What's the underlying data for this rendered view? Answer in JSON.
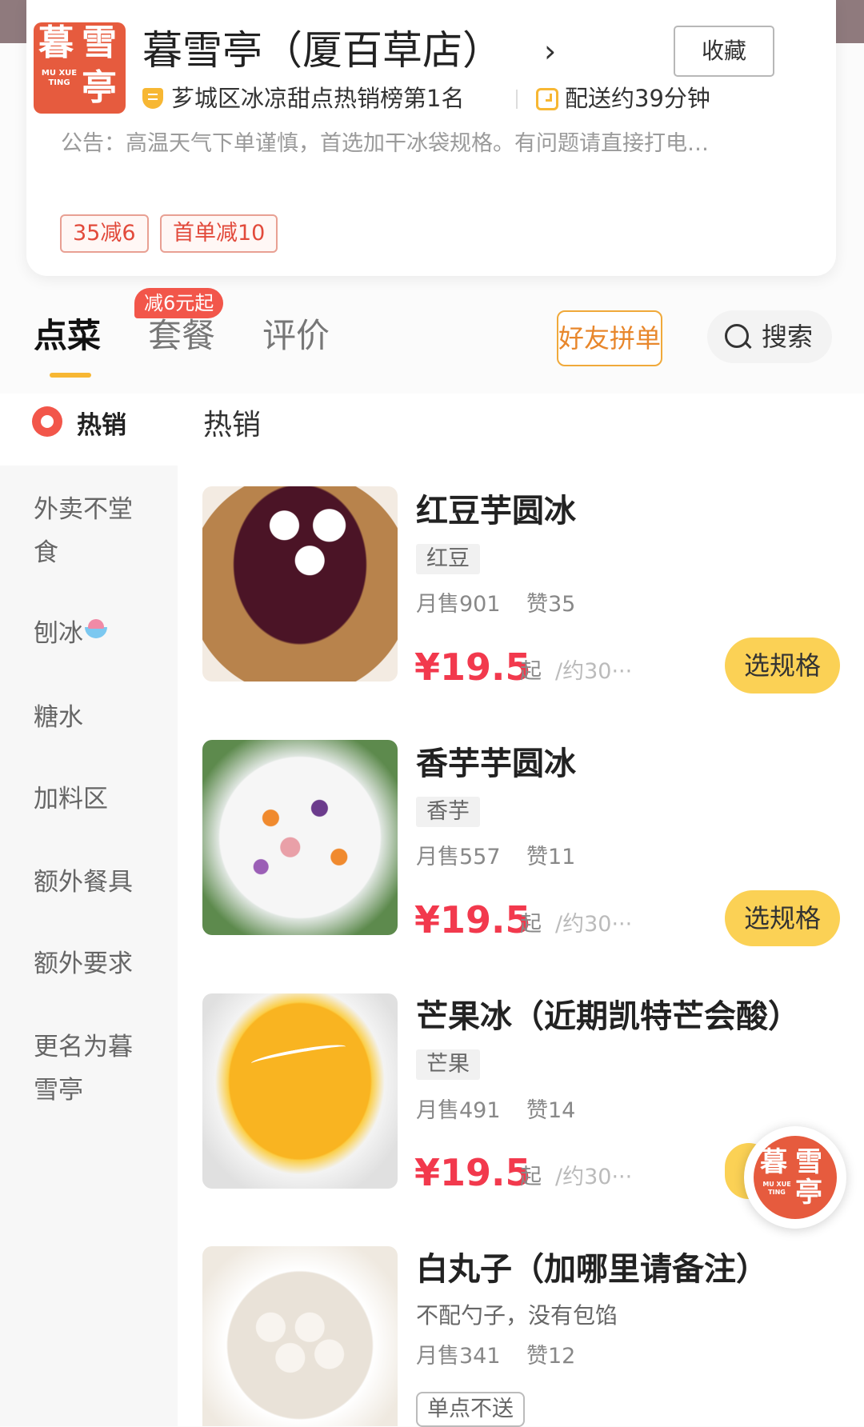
{
  "store": {
    "logo_chars": [
      "暮",
      "雪",
      "亭"
    ],
    "logo_small": "MU XUE TING",
    "name": "暮雪亭（厦百草店）",
    "chevron": "›",
    "favorite_label": "收藏",
    "ranking": "芗城区冰凉甜点热销榜第1名",
    "delivery": "配送约39分钟",
    "notice": "公告：高温天气下单谨慎，首选加干冰袋规格。有问题请直接打电…",
    "coupons": [
      "35减6",
      "首单减10"
    ]
  },
  "tabs": {
    "dishes": "点菜",
    "sets": "套餐",
    "reviews": "评价",
    "sets_badge": "减6元起",
    "group_order": "好友拼单",
    "search": "搜索"
  },
  "sidebar": {
    "items": [
      "热销",
      "外卖不堂食",
      "刨冰",
      "糖水",
      "加料区",
      "额外餐具",
      "额外要求",
      "更名为暮雪亭"
    ]
  },
  "section_title": "热销",
  "dishes": [
    {
      "name": "红豆芋圆冰",
      "tag": "红豆",
      "sales": "月售901",
      "likes": "赞35",
      "price": "¥19.5",
      "price_suffix": "起",
      "unit": "/约30···",
      "button": "选规格"
    },
    {
      "name": "香芋芋圆冰",
      "tag": "香芋",
      "sales": "月售557",
      "likes": "赞11",
      "price": "¥19.5",
      "price_suffix": "起",
      "unit": "/约30···",
      "button": "选规格"
    },
    {
      "name": "芒果冰（近期凯特芒会酸）",
      "tag": "芒果",
      "sales": "月售491",
      "likes": "赞14",
      "price": "¥19.5",
      "price_suffix": "起",
      "unit": "/约30···"
    },
    {
      "name": "白丸子（加哪里请备注）",
      "desc": "不配勺子，没有包馅",
      "sales": "月售341",
      "likes": "赞12",
      "badge": "单点不送"
    }
  ],
  "colors": {
    "brand": "#e65b3e",
    "price": "#f2394d",
    "accent_yellow": "#fbd155",
    "tab_underline": "#f7b733"
  }
}
